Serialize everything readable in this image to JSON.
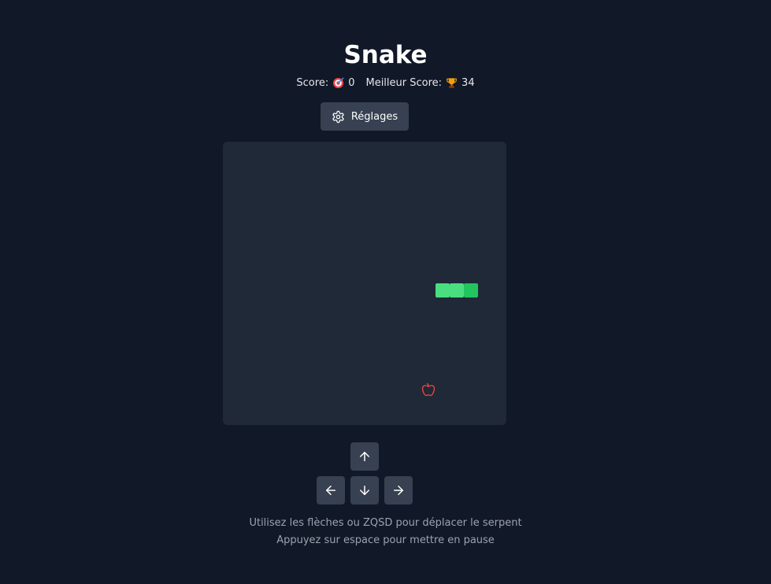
{
  "title": "Snake",
  "score": {
    "label": "Score:",
    "icon": "target-icon",
    "value": "0"
  },
  "best_score": {
    "label": "Meilleur Score:",
    "icon": "trophy-icon",
    "value": "34"
  },
  "settings_button": {
    "label": "Réglages",
    "icon": "gear-icon"
  },
  "board": {
    "grid_columns": 20,
    "grid_rows": 20,
    "snake": [
      {
        "col": 17,
        "row": 10,
        "is_head": true
      },
      {
        "col": 16,
        "row": 10,
        "is_head": false
      },
      {
        "col": 15,
        "row": 10,
        "is_head": false
      }
    ],
    "food": {
      "col": 14,
      "row": 17,
      "icon": "apple-icon"
    },
    "colors": {
      "background": "#1f2937",
      "snake_head": "#22c55e",
      "snake_body": "#4ade80",
      "food": "#ef4444"
    }
  },
  "controls": {
    "up": "arrow-up-icon",
    "left": "arrow-left-icon",
    "down": "arrow-down-icon",
    "right": "arrow-right-icon"
  },
  "instructions": {
    "line1": "Utilisez les flèches ou ZQSD pour déplacer le serpent",
    "line2": "Appuyez sur espace pour mettre en pause"
  }
}
